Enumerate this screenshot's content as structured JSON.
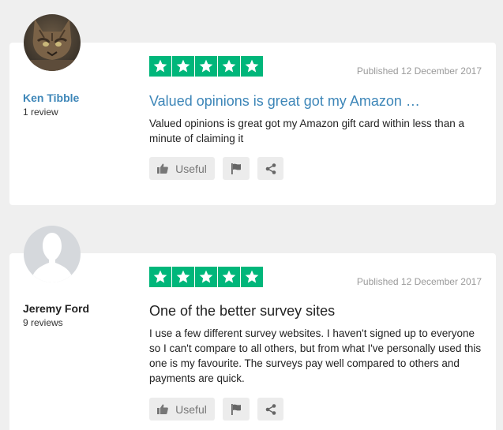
{
  "reviews": [
    {
      "reviewer_name": "Ken Tibble",
      "review_count": "1 review",
      "rating": 5,
      "published": "Published 12 December 2017",
      "title": "Valued opinions is great got my Amazon …",
      "body": "Valued opinions is great got my Amazon gift card within less than a minute of claiming it",
      "useful_label": "Useful"
    },
    {
      "reviewer_name": "Jeremy Ford",
      "review_count": "9 reviews",
      "rating": 5,
      "published": "Published 12 December 2017",
      "title": "One of the better survey sites",
      "body": "I use a few different survey websites. I haven't signed up to everyone so I can't compare to all others, but from what I've personally used this one is my favourite. The surveys pay well compared to others and payments are quick.",
      "useful_label": "Useful"
    }
  ],
  "colors": {
    "star_green": "#00b67a",
    "link_blue": "#3d86b8",
    "page_bg": "#efefef"
  },
  "icons": [
    "thumbs-up-icon",
    "flag-icon",
    "share-icon",
    "star-icon",
    "default-avatar-icon"
  ]
}
